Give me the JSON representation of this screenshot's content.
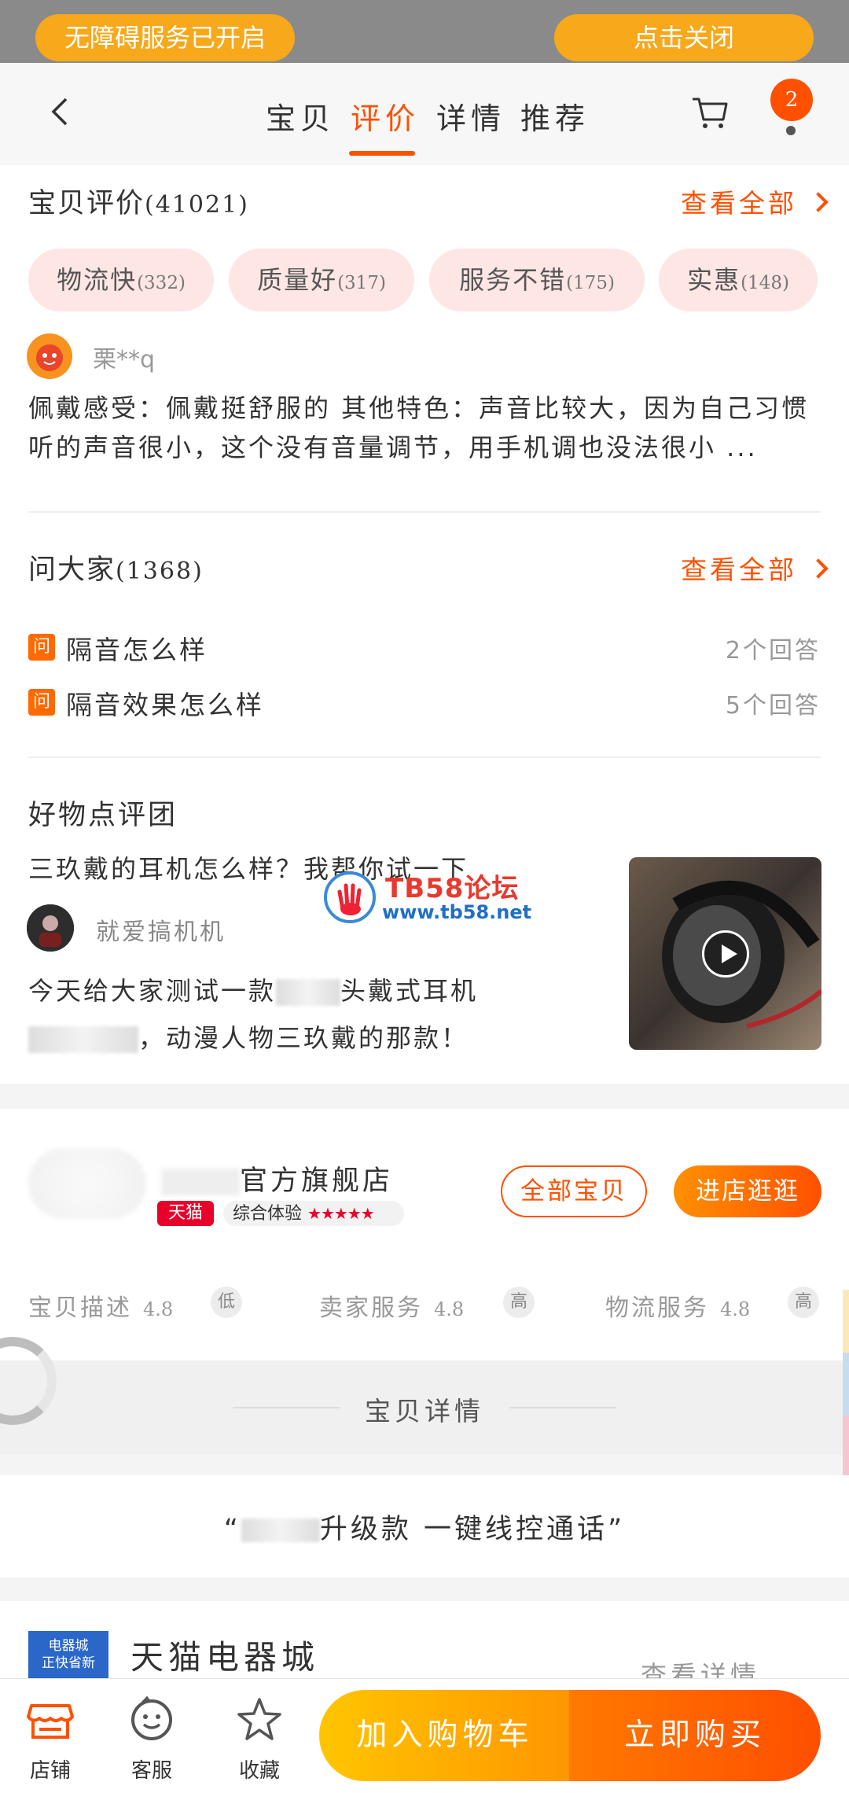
{
  "accessibility": {
    "status": "无障碍服务已开启",
    "close": "点击关闭"
  },
  "nav": {
    "tabs": [
      {
        "label": "宝贝"
      },
      {
        "label": "评价"
      },
      {
        "label": "详情"
      },
      {
        "label": "推荐"
      }
    ],
    "active_tab": "评价",
    "badge_count": "2"
  },
  "reviews": {
    "title": "宝贝评价",
    "count": "(41021)",
    "see_all": "查看全部",
    "tags": [
      {
        "label": "物流快",
        "count": "(332)"
      },
      {
        "label": "质量好",
        "count": "(317)"
      },
      {
        "label": "服务不错",
        "count": "(175)"
      },
      {
        "label": "实惠",
        "count": "(148)"
      }
    ],
    "user": "栗**q",
    "text": "佩戴感受：佩戴挺舒服的 其他特色：声音比较大，因为自己习惯听的声音很小，这个没有音量调节，用手机调也没法很小 ..."
  },
  "qa": {
    "title": "问大家",
    "count": "(1368)",
    "see_all": "查看全部",
    "icon_label": "问",
    "items": [
      {
        "question": "隔音怎么样",
        "answers": "2个回答"
      },
      {
        "question": "隔音效果怎么样",
        "answers": "5个回答"
      }
    ]
  },
  "good_review": {
    "title": "好物点评团",
    "question": "三玖戴的耳机怎么样？我帮你试一下",
    "user": "就爱搞机机",
    "body_part1": "今天给大家测试一款",
    "body_part2": "头戴式耳机",
    "body_part3": "，动漫人物三玖戴的那款！"
  },
  "watermark": {
    "line1": "TB58论坛",
    "line2": "www.tb58.net"
  },
  "shop": {
    "name_suffix": "官方旗舰店",
    "badge": "天猫",
    "experience": "综合体验",
    "stars": "★★★★★",
    "all_items": "全部宝贝",
    "enter": "进店逛逛",
    "scores": [
      {
        "label": "宝贝描述",
        "value": "4.8",
        "level": "低"
      },
      {
        "label": "卖家服务",
        "value": "4.8",
        "level": "高"
      },
      {
        "label": "物流服务",
        "value": "4.8",
        "level": "高"
      }
    ]
  },
  "detail": {
    "title": "宝贝详情",
    "quote_open": "“",
    "quote_main": "升级款 一键线控通话",
    "quote_close": "”"
  },
  "mall": {
    "logo_line1": "电器城",
    "logo_line2": "正快省新",
    "name": "天猫电器城",
    "link": "查看详情"
  },
  "bottom": {
    "shop": "店铺",
    "service": "客服",
    "favorite": "收藏",
    "add_cart": "加入购物车",
    "buy_now": "立即购买"
  },
  "colors": {
    "accent": "#ff5000",
    "tmall_red": "#e8002a",
    "cart_yellow": "#ffc500"
  }
}
